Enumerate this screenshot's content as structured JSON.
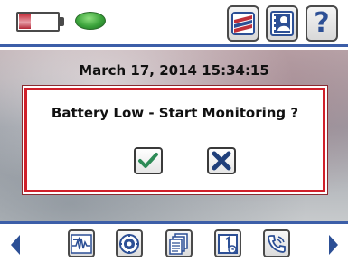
{
  "status": {
    "battery_level_fraction": 0.3,
    "battery_color": "#c83642",
    "indicator_color": "#3aa23a"
  },
  "toolbar": {
    "buttons": [
      {
        "icon": "chart-icon"
      },
      {
        "icon": "contact-card-icon"
      },
      {
        "icon": "help-icon",
        "glyph": "?"
      }
    ]
  },
  "header": {
    "datetime": "March 17, 2014 15:34:15"
  },
  "dialog": {
    "message": "Battery Low - Start Monitoring ?",
    "confirm_icon": "checkmark-icon",
    "cancel_icon": "x-icon",
    "border_color": "#d0202a"
  },
  "bottom_nav": {
    "items": [
      {
        "icon": "waveform-icon"
      },
      {
        "icon": "emblem-icon"
      },
      {
        "icon": "documents-icon"
      },
      {
        "icon": "calendar-icon"
      },
      {
        "icon": "phone-icon"
      }
    ],
    "accent_color": "#3c5ea8"
  }
}
